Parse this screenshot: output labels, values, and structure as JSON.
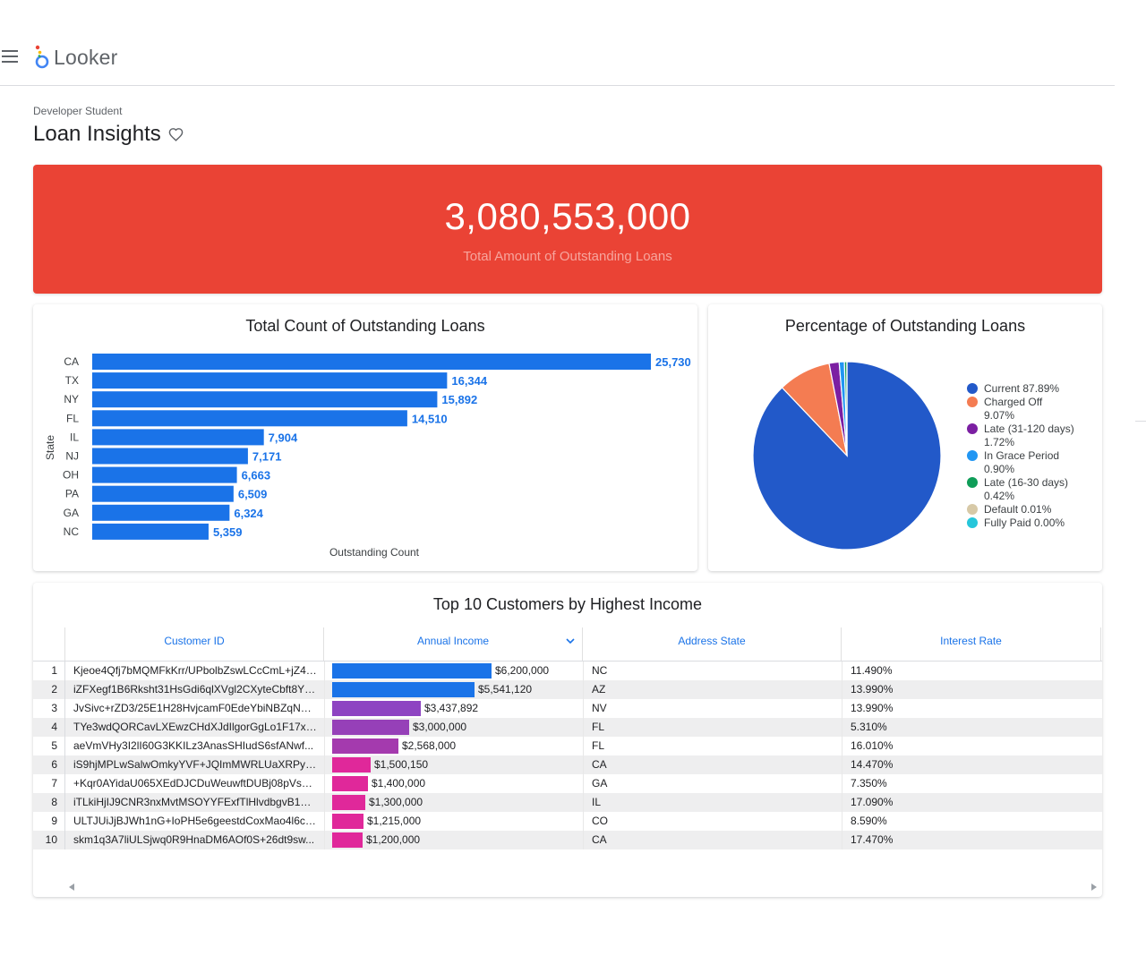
{
  "app": {
    "logo_text": "Looker",
    "breadcrumb": "Developer Student",
    "dashboard_title": "Loan Insights"
  },
  "colors": {
    "single_value_bg": "#ea4335",
    "bar_blue": "#1a73e8",
    "link_blue": "#1a73e8"
  },
  "single_value": {
    "value": "3,080,553,000",
    "label": "Total Amount of Outstanding Loans"
  },
  "bar_chart": {
    "title": "Total Count of Outstanding Loans",
    "ylabel": "State",
    "xlabel": "Outstanding Count"
  },
  "pie_chart": {
    "title": "Percentage of Outstanding Loans",
    "legend": [
      {
        "label": "Current 87.89%",
        "color": "#2259c9"
      },
      {
        "label": "Charged Off 9.07%",
        "color": "#f47c52"
      },
      {
        "label": "Late (31-120 days) 1.72%",
        "color": "#7b1fa2"
      },
      {
        "label": "In Grace Period 0.90%",
        "color": "#2196f3"
      },
      {
        "label": "Late (16-30 days) 0.42%",
        "color": "#0f9d58"
      },
      {
        "label": "Default 0.01%",
        "color": "#d7c9a7"
      },
      {
        "label": "Fully Paid 0.00%",
        "color": "#26c6da"
      }
    ]
  },
  "chart_data": [
    {
      "type": "bar",
      "orientation": "horizontal",
      "title": "Total Count of Outstanding Loans",
      "xlabel": "Outstanding Count",
      "ylabel": "State",
      "categories": [
        "CA",
        "TX",
        "NY",
        "FL",
        "IL",
        "NJ",
        "OH",
        "PA",
        "GA",
        "NC"
      ],
      "values": [
        25730,
        16344,
        15892,
        14510,
        7904,
        7171,
        6663,
        6509,
        6324,
        5359
      ],
      "value_labels": [
        "25,730",
        "16,344",
        "15,892",
        "14,510",
        "7,904",
        "7,171",
        "6,663",
        "6,509",
        "6,324",
        "5,359"
      ]
    },
    {
      "type": "pie",
      "title": "Percentage of Outstanding Loans",
      "labels": [
        "Current",
        "Charged Off",
        "Late (31-120 days)",
        "In Grace Period",
        "Late (16-30 days)",
        "Default",
        "Fully Paid"
      ],
      "values": [
        87.89,
        9.07,
        1.72,
        0.9,
        0.42,
        0.01,
        0.0
      ],
      "colors": [
        "#2259c9",
        "#f47c52",
        "#7b1fa2",
        "#2196f3",
        "#0f9d58",
        "#d7c9a7",
        "#26c6da"
      ],
      "legend": "right"
    }
  ],
  "table": {
    "title": "Top 10 Customers by Highest Income",
    "columns": [
      "Customer ID",
      "Annual Income",
      "Address State",
      "Interest Rate"
    ],
    "rows": [
      {
        "n": "1",
        "id": "Kjeoe4Qfj7bMQMFkKrr/UPbolbZswLCcCmL+jZ4/...",
        "income": 6200000,
        "income_label": "$6,200,000",
        "state": "NC",
        "rate": "11.490%",
        "bar_color": "#1a73e8"
      },
      {
        "n": "2",
        "id": "iZFXegf1B6Rksht31HsGdi6qlXVgl2CXyteCbft8Y+...",
        "income": 5541120,
        "income_label": "$5,541,120",
        "state": "AZ",
        "rate": "13.990%",
        "bar_color": "#1a73e8"
      },
      {
        "n": "3",
        "id": "JvSivc+rZD3/25E1H28HvjcamF0EdeYbiNBZqNno...",
        "income": 3437892,
        "income_label": "$3,437,892",
        "state": "NV",
        "rate": "13.990%",
        "bar_color": "#8e44c2"
      },
      {
        "n": "4",
        "id": "TYe3wdQORCavLXEwzCHdXJdIlgorGgLo1F17xxv...",
        "income": 3000000,
        "income_label": "$3,000,000",
        "state": "FL",
        "rate": "5.310%",
        "bar_color": "#9640b8"
      },
      {
        "n": "5",
        "id": "aeVmVHy3I2lI60G3KKILz3AnasSHIudS6sfANwf...",
        "income": 2568000,
        "income_label": "$2,568,000",
        "state": "FL",
        "rate": "16.010%",
        "bar_color": "#a43aae"
      },
      {
        "n": "6",
        "id": "iS9hjMPLwSalwOmkyYVF+JQImMWRLUaXRPy1q...",
        "income": 1500150,
        "income_label": "$1,500,150",
        "state": "CA",
        "rate": "14.470%",
        "bar_color": "#e0289a"
      },
      {
        "n": "7",
        "id": "+Kqr0AYidaU065XEdDJCDuWeuwftDUBj08pVsS1...",
        "income": 1400000,
        "income_label": "$1,400,000",
        "state": "GA",
        "rate": "7.350%",
        "bar_color": "#e0289a"
      },
      {
        "n": "8",
        "id": "iTLkiHjIJ9CNR3nxMvtMSOYYFExfTlHlvdbgvB1aw...",
        "income": 1300000,
        "income_label": "$1,300,000",
        "state": "IL",
        "rate": "17.090%",
        "bar_color": "#e0289a"
      },
      {
        "n": "9",
        "id": "ULTJUiJjBJWh1nG+IoPH5e6geestdCoxMao4l6cf...",
        "income": 1215000,
        "income_label": "$1,215,000",
        "state": "CO",
        "rate": "8.590%",
        "bar_color": "#e0289a"
      },
      {
        "n": "10",
        "id": "skm1q3A7liULSjwq0R9HnaDM6AOf0S+26dt9sw...",
        "income": 1200000,
        "income_label": "$1,200,000",
        "state": "CA",
        "rate": "17.470%",
        "bar_color": "#e0289a"
      }
    ]
  }
}
